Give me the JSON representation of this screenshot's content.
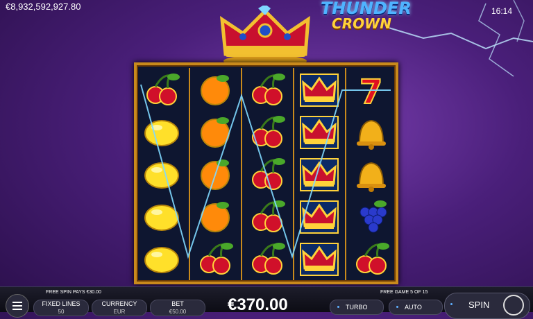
{
  "header": {
    "balance": "€8,932,592,927.80",
    "clock": "16:14"
  },
  "logo": {
    "line1": "THUNDER",
    "line2": "CROWN"
  },
  "reels": [
    [
      "cherry",
      "lemon",
      "lemon",
      "lemon",
      "lemon"
    ],
    [
      "orange",
      "orange",
      "orange",
      "orange",
      "cherry"
    ],
    [
      "cherry",
      "cherry",
      "cherry",
      "cherry",
      "cherry"
    ],
    [
      "crown",
      "crown",
      "crown",
      "crown",
      "crown"
    ],
    [
      "seven",
      "bell",
      "bell",
      "grapes",
      "cherry"
    ]
  ],
  "info": {
    "left": "FREE SPIN PAYS €30.00",
    "right": "FREE GAME 5 OF 15"
  },
  "controls": {
    "fixed_lines_label": "FIXED LINES",
    "fixed_lines_value": "50",
    "currency_label": "CURRENCY",
    "currency_value": "EUR",
    "bet_label": "BET",
    "bet_value": "€50.00",
    "win_amount": "€370.00",
    "turbo": "TURBO",
    "auto": "AUTO",
    "spin": "SPIN"
  },
  "colors": {
    "frame": "#c98a1c",
    "line": "#7fd8ff"
  }
}
